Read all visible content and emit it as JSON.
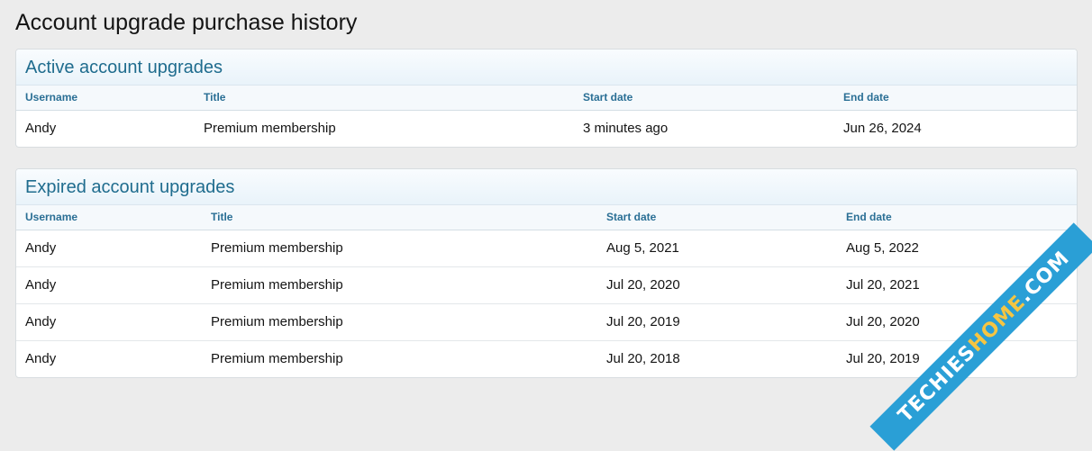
{
  "page_title": "Account upgrade purchase history",
  "active": {
    "heading": "Active account upgrades",
    "columns": [
      "Username",
      "Title",
      "Start date",
      "End date"
    ],
    "rows": [
      [
        "Andy",
        "Premium membership",
        "3 minutes ago",
        "Jun 26, 2024"
      ]
    ]
  },
  "expired": {
    "heading": "Expired account upgrades",
    "columns": [
      "Username",
      "Title",
      "Start date",
      "End date"
    ],
    "rows": [
      [
        "Andy",
        "Premium membership",
        "Aug 5, 2021",
        "Aug 5, 2022"
      ],
      [
        "Andy",
        "Premium membership",
        "Jul 20, 2020",
        "Jul 20, 2021"
      ],
      [
        "Andy",
        "Premium membership",
        "Jul 20, 2019",
        "Jul 20, 2020"
      ],
      [
        "Andy",
        "Premium membership",
        "Jul 20, 2018",
        "Jul 20, 2019"
      ]
    ]
  },
  "watermark": {
    "part1": "TECHIES",
    "part2": "HOME",
    "part3": ".COM"
  },
  "colors": {
    "heading_text": "#1f6c8e",
    "column_header_text": "#2a6f95",
    "watermark_bg": "#2a9fd6",
    "watermark_accent": "#f5c542"
  }
}
